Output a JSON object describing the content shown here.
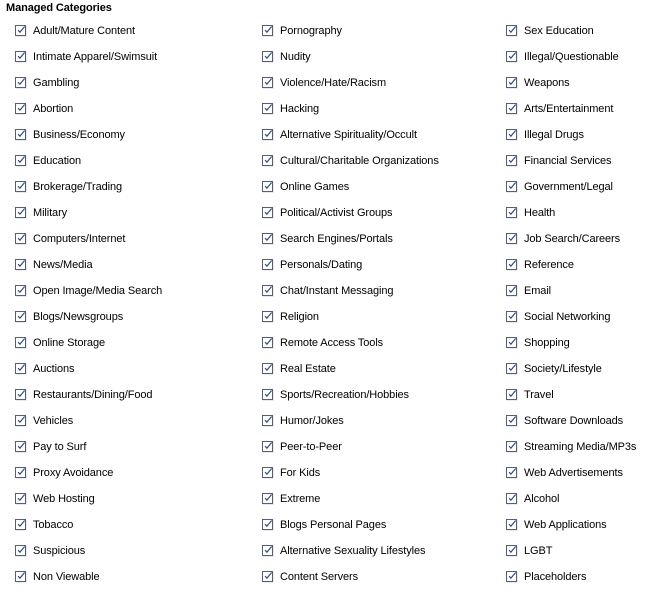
{
  "panel": {
    "title": "Managed Categories",
    "checkbox_icon": "checkmark-icon",
    "checkbox_checked": true,
    "accent_color": "#2b4b8f",
    "border_color": "#5a5f6e",
    "background_color": "#ffffff",
    "text_color": "#000000"
  },
  "columns": [
    {
      "index": 0,
      "items": [
        {
          "label": "Adult/Mature Content",
          "checked": true
        },
        {
          "label": "Intimate Apparel/Swimsuit",
          "checked": true
        },
        {
          "label": "Gambling",
          "checked": true
        },
        {
          "label": "Abortion",
          "checked": true
        },
        {
          "label": "Business/Economy",
          "checked": true
        },
        {
          "label": "Education",
          "checked": true
        },
        {
          "label": "Brokerage/Trading",
          "checked": true
        },
        {
          "label": "Military",
          "checked": true
        },
        {
          "label": "Computers/Internet",
          "checked": true
        },
        {
          "label": "News/Media",
          "checked": true
        },
        {
          "label": "Open Image/Media Search",
          "checked": true
        },
        {
          "label": "Blogs/Newsgroups",
          "checked": true
        },
        {
          "label": "Online Storage",
          "checked": true
        },
        {
          "label": "Auctions",
          "checked": true
        },
        {
          "label": "Restaurants/Dining/Food",
          "checked": true
        },
        {
          "label": "Vehicles",
          "checked": true
        },
        {
          "label": "Pay to Surf",
          "checked": true
        },
        {
          "label": "Proxy Avoidance",
          "checked": true
        },
        {
          "label": "Web Hosting",
          "checked": true
        },
        {
          "label": "Tobacco",
          "checked": true
        },
        {
          "label": "Suspicious",
          "checked": true
        },
        {
          "label": "Non Viewable",
          "checked": true
        }
      ]
    },
    {
      "index": 1,
      "items": [
        {
          "label": "Pornography",
          "checked": true
        },
        {
          "label": "Nudity",
          "checked": true
        },
        {
          "label": "Violence/Hate/Racism",
          "checked": true
        },
        {
          "label": "Hacking",
          "checked": true
        },
        {
          "label": "Alternative Spirituality/Occult",
          "checked": true
        },
        {
          "label": "Cultural/Charitable Organizations",
          "checked": true
        },
        {
          "label": "Online Games",
          "checked": true
        },
        {
          "label": "Political/Activist Groups",
          "checked": true
        },
        {
          "label": "Search Engines/Portals",
          "checked": true
        },
        {
          "label": "Personals/Dating",
          "checked": true
        },
        {
          "label": "Chat/Instant Messaging",
          "checked": true
        },
        {
          "label": "Religion",
          "checked": true
        },
        {
          "label": "Remote Access Tools",
          "checked": true
        },
        {
          "label": "Real Estate",
          "checked": true
        },
        {
          "label": "Sports/Recreation/Hobbies",
          "checked": true
        },
        {
          "label": "Humor/Jokes",
          "checked": true
        },
        {
          "label": "Peer-to-Peer",
          "checked": true
        },
        {
          "label": "For Kids",
          "checked": true
        },
        {
          "label": "Extreme",
          "checked": true
        },
        {
          "label": "Blogs Personal Pages",
          "checked": true
        },
        {
          "label": "Alternative Sexuality Lifestyles",
          "checked": true
        },
        {
          "label": "Content Servers",
          "checked": true
        }
      ]
    },
    {
      "index": 2,
      "items": [
        {
          "label": "Sex Education",
          "checked": true
        },
        {
          "label": "Illegal/Questionable",
          "checked": true
        },
        {
          "label": "Weapons",
          "checked": true
        },
        {
          "label": "Arts/Entertainment",
          "checked": true
        },
        {
          "label": "Illegal Drugs",
          "checked": true
        },
        {
          "label": "Financial Services",
          "checked": true
        },
        {
          "label": "Government/Legal",
          "checked": true
        },
        {
          "label": "Health",
          "checked": true
        },
        {
          "label": "Job Search/Careers",
          "checked": true
        },
        {
          "label": "Reference",
          "checked": true
        },
        {
          "label": "Email",
          "checked": true
        },
        {
          "label": "Social Networking",
          "checked": true
        },
        {
          "label": "Shopping",
          "checked": true
        },
        {
          "label": "Society/Lifestyle",
          "checked": true
        },
        {
          "label": "Travel",
          "checked": true
        },
        {
          "label": "Software Downloads",
          "checked": true
        },
        {
          "label": "Streaming Media/MP3s",
          "checked": true
        },
        {
          "label": "Web Advertisements",
          "checked": true
        },
        {
          "label": "Alcohol",
          "checked": true
        },
        {
          "label": "Web Applications",
          "checked": true
        },
        {
          "label": "LGBT",
          "checked": true
        },
        {
          "label": "Placeholders",
          "checked": true
        }
      ]
    }
  ]
}
